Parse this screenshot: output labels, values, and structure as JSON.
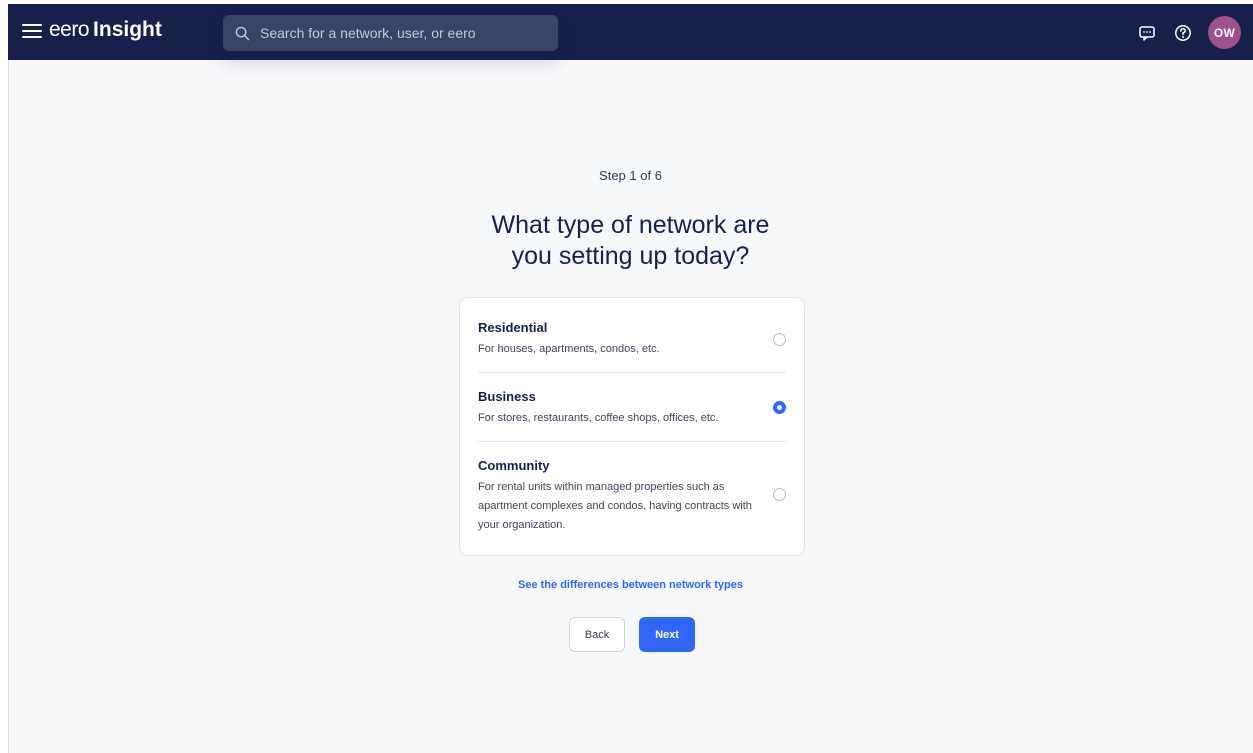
{
  "header": {
    "brand_light": "eero",
    "brand_bold": "Insight",
    "search_placeholder": "Search for a network, user, or eero",
    "avatar_initials": "OW",
    "avatar_color": "#a04f8f",
    "icons": [
      "menu-icon",
      "search-icon",
      "chat-icon",
      "help-icon"
    ]
  },
  "wizard": {
    "step_label": "Step 1 of 6",
    "title_line1": "What type of network are",
    "title_line2": "you setting up today?",
    "options": [
      {
        "title": "Residential",
        "description": "For houses, apartments, condos, etc.",
        "selected": false
      },
      {
        "title": "Business",
        "description": "For stores, restaurants, coffee shops, offices, etc.",
        "selected": true
      },
      {
        "title": "Community",
        "description": "For rental units within managed properties such as apartment complexes and condos, having contracts with your organization.",
        "selected": false
      }
    ],
    "differences_link": "See the differences between network types",
    "back_label": "Back",
    "next_label": "Next"
  },
  "colors": {
    "topbar": "#16204a",
    "accent": "#2f66f6",
    "background": "#f7f8fa"
  }
}
